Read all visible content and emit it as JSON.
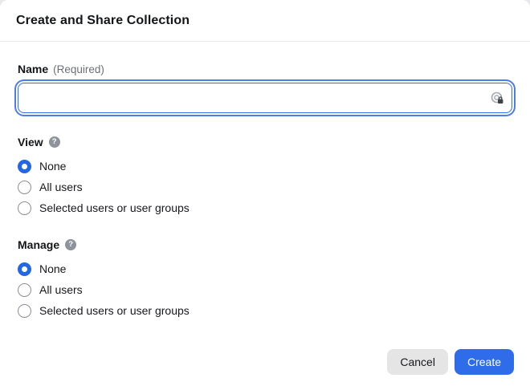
{
  "dialog": {
    "title": "Create and Share Collection"
  },
  "name_field": {
    "label": "Name",
    "required_note": "(Required)",
    "value": "",
    "autofill_icon": "password-manager-lock-icon"
  },
  "view_section": {
    "label": "View",
    "help_glyph": "?",
    "options": [
      {
        "label": "None",
        "selected": true
      },
      {
        "label": "All users",
        "selected": false
      },
      {
        "label": "Selected users or user groups",
        "selected": false
      }
    ]
  },
  "manage_section": {
    "label": "Manage",
    "help_glyph": "?",
    "options": [
      {
        "label": "None",
        "selected": true
      },
      {
        "label": "All users",
        "selected": false
      },
      {
        "label": "Selected users or user groups",
        "selected": false
      }
    ]
  },
  "footer": {
    "cancel_label": "Cancel",
    "create_label": "Create"
  },
  "colors": {
    "accent_blue": "#2f6ce9",
    "radio_blue": "#2467e5",
    "cancel_gray": "#e5e5e6",
    "divider": "#e7e7e9"
  }
}
